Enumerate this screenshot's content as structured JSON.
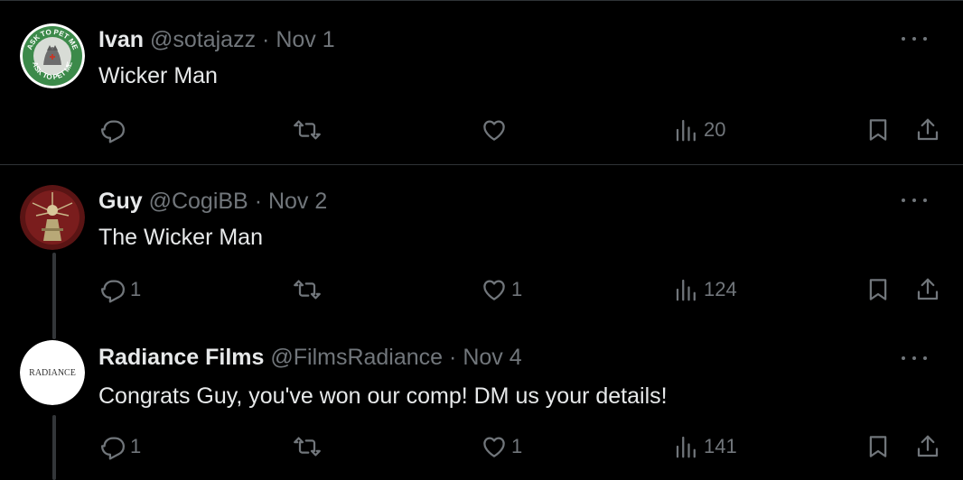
{
  "colors": {
    "background": "#000000",
    "text_primary": "#e7e9ea",
    "text_secondary": "#71767b",
    "divider": "#2f3336"
  },
  "icons": {
    "more": "more-icon",
    "reply": "reply-icon",
    "retweet": "retweet-icon",
    "like": "like-icon",
    "views": "views-icon",
    "bookmark": "bookmark-icon",
    "share": "share-icon"
  },
  "tweets": [
    {
      "name": "Ivan",
      "handle": "@sotajazz",
      "separator": "·",
      "date": "Nov 1",
      "text": "Wicker Man",
      "avatar_text_top": "ASK TO PET ME",
      "avatar_text_bottom": "ASK TO PET ME",
      "replies": "",
      "retweets": "",
      "likes": "",
      "views": "20"
    },
    {
      "name": "Guy",
      "handle": "@CogiBB",
      "separator": "·",
      "date": "Nov 2",
      "text": "The Wicker Man",
      "replies": "1",
      "retweets": "",
      "likes": "1",
      "views": "124"
    },
    {
      "name": "Radiance Films",
      "handle": "@FilmsRadiance",
      "separator": "·",
      "date": "Nov 4",
      "text": "Congrats Guy, you've won our comp! DM us your details!",
      "avatar_logo": "RADIANCE",
      "replies": "1",
      "retweets": "",
      "likes": "1",
      "views": "141"
    }
  ]
}
